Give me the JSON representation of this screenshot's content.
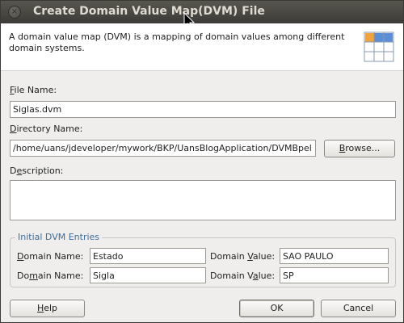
{
  "window": {
    "title": "Create Domain Value Map(DVM) File",
    "close_glyph": "×"
  },
  "header": {
    "description": "A domain value map (DVM) is a mapping of domain values among different domain systems.",
    "icon": "dvm-table-icon"
  },
  "form": {
    "file_name": {
      "label_mnemonic": "F",
      "label_rest": "ile Name:",
      "value": "Siglas.dvm"
    },
    "directory_name": {
      "label_mnemonic": "D",
      "label_rest": "irectory Name:",
      "value": "/home/uans/jdeveloper/mywork/BKP/UansBlogApplication/DVMBpel"
    },
    "browse_button": {
      "mnemonic": "B",
      "rest": "rowse..."
    },
    "description": {
      "label_pre": "D",
      "label_mnemonic": "e",
      "label_rest": "scription:",
      "value": ""
    }
  },
  "entries": {
    "group_title": "Initial DVM Entries",
    "rows": [
      {
        "name_label_pre": "",
        "name_label_mnemonic": "D",
        "name_label_rest": "omain Name:",
        "name_value": "Estado",
        "value_label_pre": "Domain ",
        "value_label_mnemonic": "V",
        "value_label_rest": "alue:",
        "value_value": "SAO PAULO"
      },
      {
        "name_label_pre": "Do",
        "name_label_mnemonic": "m",
        "name_label_rest": "ain Name:",
        "name_value": "Sigla",
        "value_label_pre": "Domain V",
        "value_label_mnemonic": "a",
        "value_label_rest": "lue:",
        "value_value": "SP"
      }
    ]
  },
  "buttons": {
    "help": {
      "mnemonic": "H",
      "rest": "elp"
    },
    "ok": "OK",
    "cancel": "Cancel"
  },
  "colors": {
    "titlebar": "#3c3b37",
    "dialog_bg": "#efeeed",
    "group_title": "#3e6d9c",
    "icon_orange": "#f0a23c",
    "icon_blue": "#5b8ed6"
  }
}
